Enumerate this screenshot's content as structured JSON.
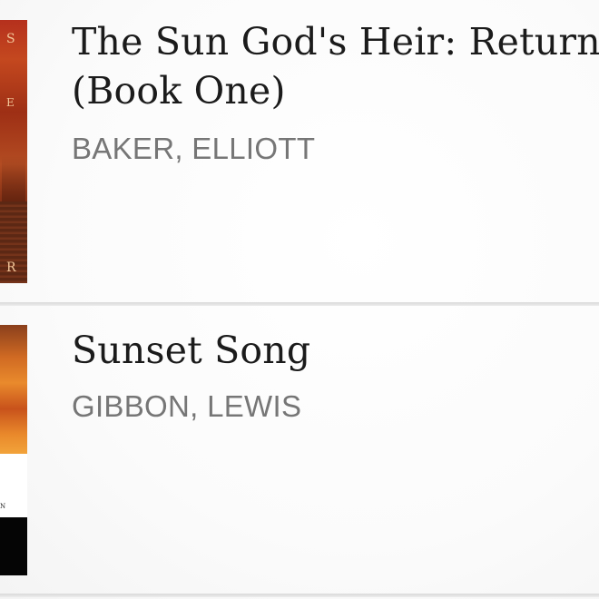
{
  "books": [
    {
      "title_line_1": "The Sun God's Heir: Return",
      "title_line_2": "(Book One)",
      "author": "BAKER, ELLIOTT",
      "cover_letters": [
        "S",
        "E",
        "R"
      ]
    },
    {
      "title_line_1": "Sunset Song",
      "author": "GIBBON, LEWIS",
      "cover_letters": [
        "N"
      ]
    }
  ],
  "colors": {
    "title": "#1b1b1b",
    "author": "#767676",
    "divider": "#d9d9d9"
  }
}
